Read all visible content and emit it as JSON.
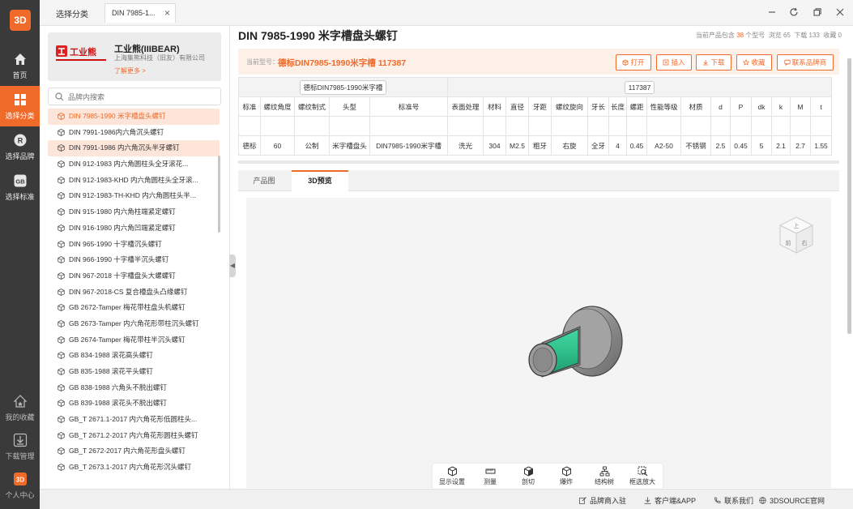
{
  "rail": {
    "logo": "3D",
    "items": [
      {
        "label": "首页",
        "icon": "home-icon"
      },
      {
        "label": "选择分类",
        "icon": "grid-icon"
      },
      {
        "label": "选择品牌",
        "icon": "brand-r-icon"
      },
      {
        "label": "选择标准",
        "icon": "gb-standard-icon"
      }
    ],
    "bottom": [
      {
        "label": "我的收藏",
        "icon": "favorite-house-icon"
      },
      {
        "label": "下载管理",
        "icon": "download-icon"
      },
      {
        "label": "个人中心",
        "icon": "user-3d-icon"
      }
    ]
  },
  "topbar": {
    "tab_plain": "选择分类",
    "tab_active": "DIN 7985-1...",
    "tab_close": "×"
  },
  "brand": {
    "logo_text": "工业熊",
    "name": "工业熊(IIIBEAR)",
    "sub": "上海集熊科技（旧友）有限公司",
    "more": "了解更多 >"
  },
  "search": {
    "placeholder": "品牌内搜索"
  },
  "catalog": {
    "items": [
      "DIN 7985-1990 米字槽盘头螺钉",
      "DIN 7991-1986内六角沉头螺钉",
      "DIN 7991-1986 内六角沉头半牙螺钉",
      "DIN 912-1983 内六角圆柱头全牙滚花...",
      "DIN 912-1983-KHD 内六角圆柱头全牙滚...",
      "DIN 912-1983-TH-KHD 内六角圆柱头半...",
      "DIN 915-1980 内六角柱端紧定螺钉",
      "DIN 916-1980 内六角凹端紧定螺钉",
      "DIN 965-1990 十字槽沉头螺钉",
      "DIN 966-1990 十字槽半沉头螺钉",
      "DIN 967-2018 十字槽盘头大螺螺钉",
      "DIN 967-2018-CS 复合槽盘头凸缘螺钉",
      "GB 2672-Tamper 梅花带柱盘头机螺钉",
      "GB 2673-Tamper 内六角花形带柱沉头螺钉",
      "GB 2674-Tamper 梅花带柱半沉头螺钉",
      "GB 834-1988 滚花高头螺钉",
      "GB 835-1988 滚花平头螺钉",
      "GB 838-1988 六角头不脱出螺钉",
      "GB 839-1988 滚花头不脱出螺钉",
      "GB_T 2671.1-2017 内六角花形低圆柱头...",
      "GB_T 2671.2-2017 内六角花形圆柱头螺钉",
      "GB_T 2672-2017 内六角花形盘头螺钉",
      "GB_T 2673.1-2017 内六角花形沉头螺钉"
    ]
  },
  "collapse_arrow": "◀",
  "product": {
    "title": "DIN 7985-1990 米字槽盘头螺钉",
    "stats": {
      "current_prefix": "当前产品包含",
      "count": "38",
      "count_suffix": "个型号",
      "views": "浏览 65",
      "downloads": "下载 133",
      "favorites": "收藏 0"
    },
    "code_label": "当前型号：",
    "code_value": "德标DIN7985-1990米字槽 117387",
    "actions": [
      "打开",
      "插入",
      "下载",
      "收藏",
      "联系品牌商"
    ]
  },
  "spec_table": {
    "group_left": "德标DIN7985-1990米字槽",
    "group_right": "117387",
    "headers": [
      "标准",
      "螺纹角度",
      "螺纹制式",
      "头型",
      "标准号",
      "表面处理",
      "材料",
      "直径",
      "牙距",
      "螺纹旋向",
      "牙长",
      "长度",
      "螺距",
      "性能等级",
      "材质",
      "d",
      "P",
      "dk",
      "k",
      "M",
      "t"
    ],
    "values": [
      "德标",
      "60",
      "公制",
      "米字槽盘头",
      "DIN7985-1990米字槽",
      "洗光",
      "304",
      "M2.5",
      "粗牙",
      "右旋",
      "全牙",
      "4",
      "0.45",
      "A2-50",
      "不锈钢",
      "2.5",
      "0.45",
      "5",
      "2.1",
      "2.7",
      "1.55"
    ]
  },
  "preview_tabs": [
    "产品图",
    "3D预览"
  ],
  "viewcube": {
    "top": "上",
    "front": "前",
    "right": "右"
  },
  "viewer_tools": [
    "显示设置",
    "测量",
    "剖切",
    "爆炸",
    "结构树",
    "框选放大"
  ],
  "colors": {
    "accent": "#f06a2a",
    "part_green": "#2fbf8a",
    "part_grey": "#8a8a8a"
  },
  "statusbar": [
    "品牌商入驻",
    "客户端&APP",
    "联系我们",
    "3DSOURCE官网"
  ]
}
